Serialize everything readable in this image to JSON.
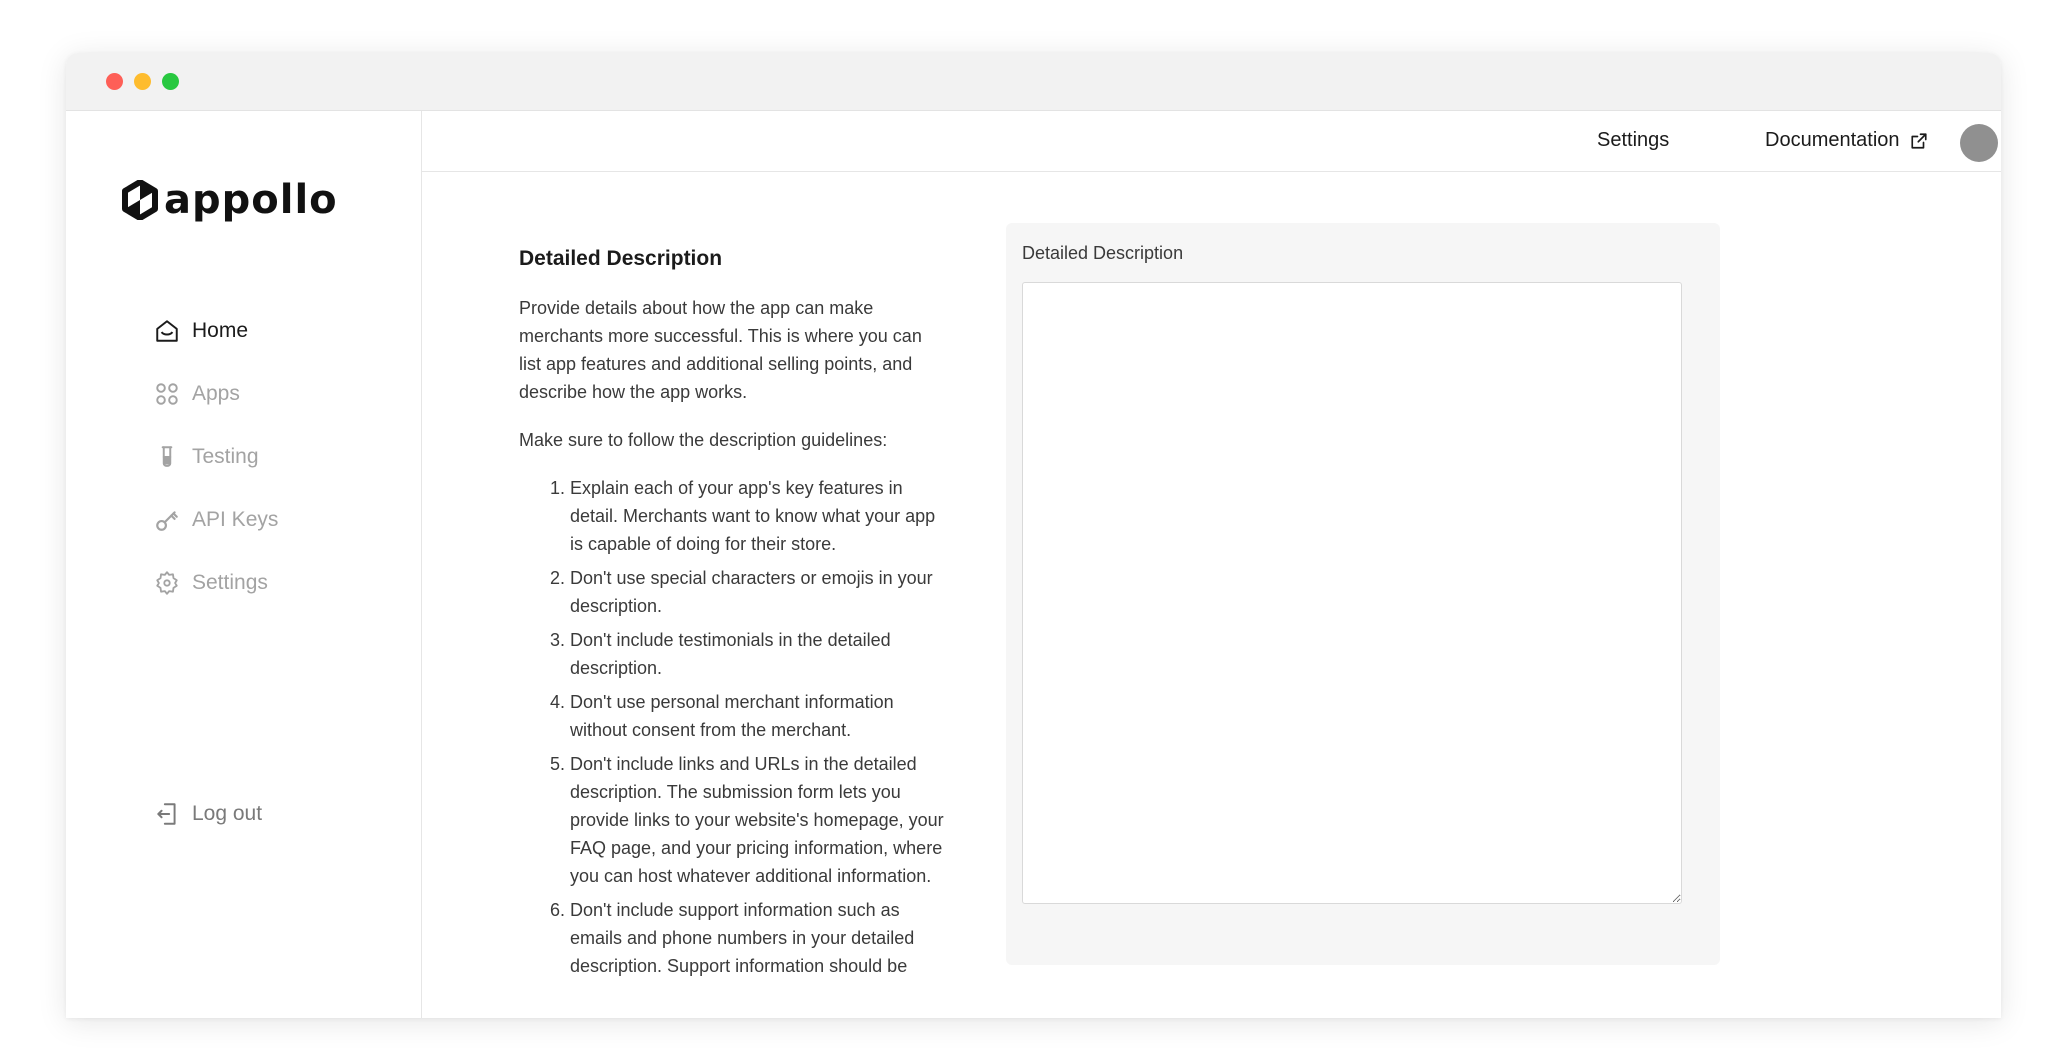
{
  "brand": {
    "name": "appollo"
  },
  "sidebar": {
    "items": [
      {
        "label": "Home",
        "icon": "home-icon",
        "active": true
      },
      {
        "label": "Apps",
        "icon": "apps-grid-icon",
        "active": false
      },
      {
        "label": "Testing",
        "icon": "test-tube-icon",
        "active": false
      },
      {
        "label": "API Keys",
        "icon": "key-icon",
        "active": false
      },
      {
        "label": "Settings",
        "icon": "gear-icon",
        "active": false
      }
    ],
    "logout_label": "Log out"
  },
  "topbar": {
    "settings_label": "Settings",
    "documentation_label": "Documentation"
  },
  "main": {
    "section_title": "Detailed Description",
    "intro": "Provide details about how the app can make merchants more successful. This is where you can list app features and additional selling points, and describe how the app works.",
    "guidelines_intro": "Make sure to follow the description guidelines:",
    "guidelines": [
      "Explain each of your app's key features in detail. Merchants want to know what your app is capable of doing for their store.",
      "Don't use special characters or emojis in your description.",
      "Don't include testimonials in the detailed description.",
      "Don't use personal merchant information without consent from the merchant.",
      "Don't include links and URLs in the detailed description. The submission form lets you provide links to your website's homepage, your FAQ page, and your pricing information, where you can host whatever additional information.",
      "Don't include support information such as emails and phone numbers in your detailed description. Support information should be"
    ],
    "field": {
      "label": "Detailed Description",
      "value": "",
      "placeholder": ""
    }
  },
  "colors": {
    "sidebar_inactive": "#a3a3a3",
    "card_background": "#f6f6f6",
    "avatar": "#909090"
  }
}
